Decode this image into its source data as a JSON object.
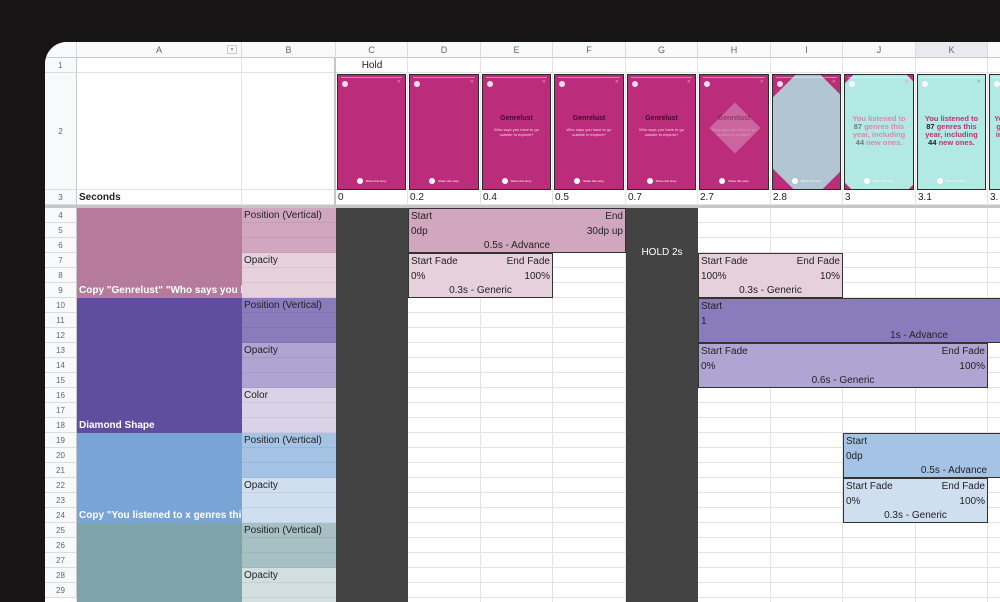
{
  "columns": [
    "A",
    "B",
    "C",
    "D",
    "E",
    "F",
    "G",
    "H",
    "I",
    "J",
    "K",
    ""
  ],
  "rows": [
    "1",
    "2",
    "3",
    "4",
    "5",
    "6",
    "7",
    "8",
    "9",
    "10",
    "11",
    "12",
    "13",
    "14",
    "15",
    "16",
    "17",
    "18",
    "19",
    "20",
    "21",
    "22",
    "23",
    "24",
    "25",
    "26",
    "27",
    "28",
    "29"
  ],
  "row1": {
    "c": "Hold"
  },
  "row3": {
    "a": "Seconds",
    "times": [
      "0",
      "0.2",
      "0.4",
      "0.5",
      "0.7",
      "2.7",
      "2.8",
      "3",
      "3.1",
      "3."
    ]
  },
  "frames": {
    "share": "Share this story",
    "genre_title": "Genrelust",
    "genre_sub": "Who says you have to go outside to explore?",
    "listened_pre": "You listened to ",
    "genres_count": "87",
    "listened_mid": " genres this year, including ",
    "new_count": "44",
    "listened_post": " new ones.",
    "colors": {
      "pink": "#bb2d7a",
      "teal": "#b2e9e2",
      "diamond": "#b1c6d2"
    }
  },
  "groups": [
    {
      "label": "Copy \"Genrelust\" \"Who says you have to go outside to explore?\"",
      "color": "#b67b9b",
      "props": [
        "Position (Vertical)",
        "Opacity"
      ]
    },
    {
      "label": "Diamond Shape",
      "color": "#5f4e9f",
      "props": [
        "Position (Vertical)",
        "Opacity",
        "Color"
      ]
    },
    {
      "label": "Copy \"You listened to x genres this year, including x new ones.\"",
      "color": "#79a5d6",
      "props": [
        "Position (Vertical)",
        "Opacity"
      ]
    },
    {
      "label": "",
      "color": "#7ea3ab",
      "props": [
        "Position (Vertical)",
        "Opacity"
      ]
    }
  ],
  "hold": "HOLD 2s",
  "blocks": {
    "genre_pos": {
      "start": "Start",
      "end": "End",
      "from": "0dp",
      "to": "30dp up",
      "timing": "0.5s - Advance"
    },
    "genre_fadein": {
      "start": "Start Fade",
      "end": "End Fade",
      "from": "0%",
      "to": "100%",
      "timing": "0.3s - Generic"
    },
    "genre_fadeout": {
      "start": "Start Fade",
      "end": "End Fade",
      "from": "100%",
      "to": "10%",
      "timing": "0.3s - Generic"
    },
    "dia_pos": {
      "start": "Start",
      "from": "1",
      "timing": "1s - Advance"
    },
    "dia_fade": {
      "start": "Start Fade",
      "end": "End Fade",
      "from": "0%",
      "to": "100%",
      "timing": "0.6s - Generic"
    },
    "copy_pos": {
      "start": "Start",
      "from": "0dp",
      "timing": "0.5s - Advance"
    },
    "copy_fade": {
      "start": "Start Fade",
      "end": "End Fade",
      "from": "0%",
      "to": "100%",
      "timing": "0.3s - Generic"
    }
  }
}
